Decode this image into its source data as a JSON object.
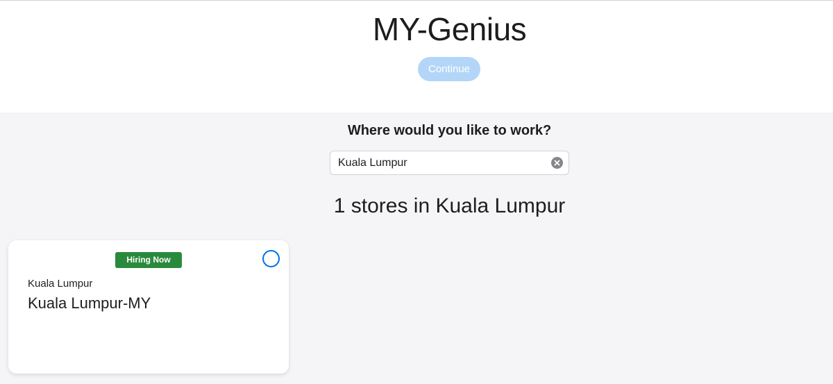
{
  "header": {
    "title": "MY-Genius",
    "continue_label": "Continue"
  },
  "search": {
    "question": "Where would you like to work?",
    "value": "Kuala Lumpur",
    "clear_icon": "clear-icon"
  },
  "results": {
    "title": "1 stores in Kuala Lumpur"
  },
  "stores": [
    {
      "badge": "Hiring Now",
      "city": "Kuala Lumpur",
      "name": "Kuala Lumpur-MY",
      "selected": false
    }
  ],
  "colors": {
    "accent": "#0071e3",
    "continue_disabled_bg": "#b3d6f8",
    "badge_green": "#2a8a3c"
  }
}
